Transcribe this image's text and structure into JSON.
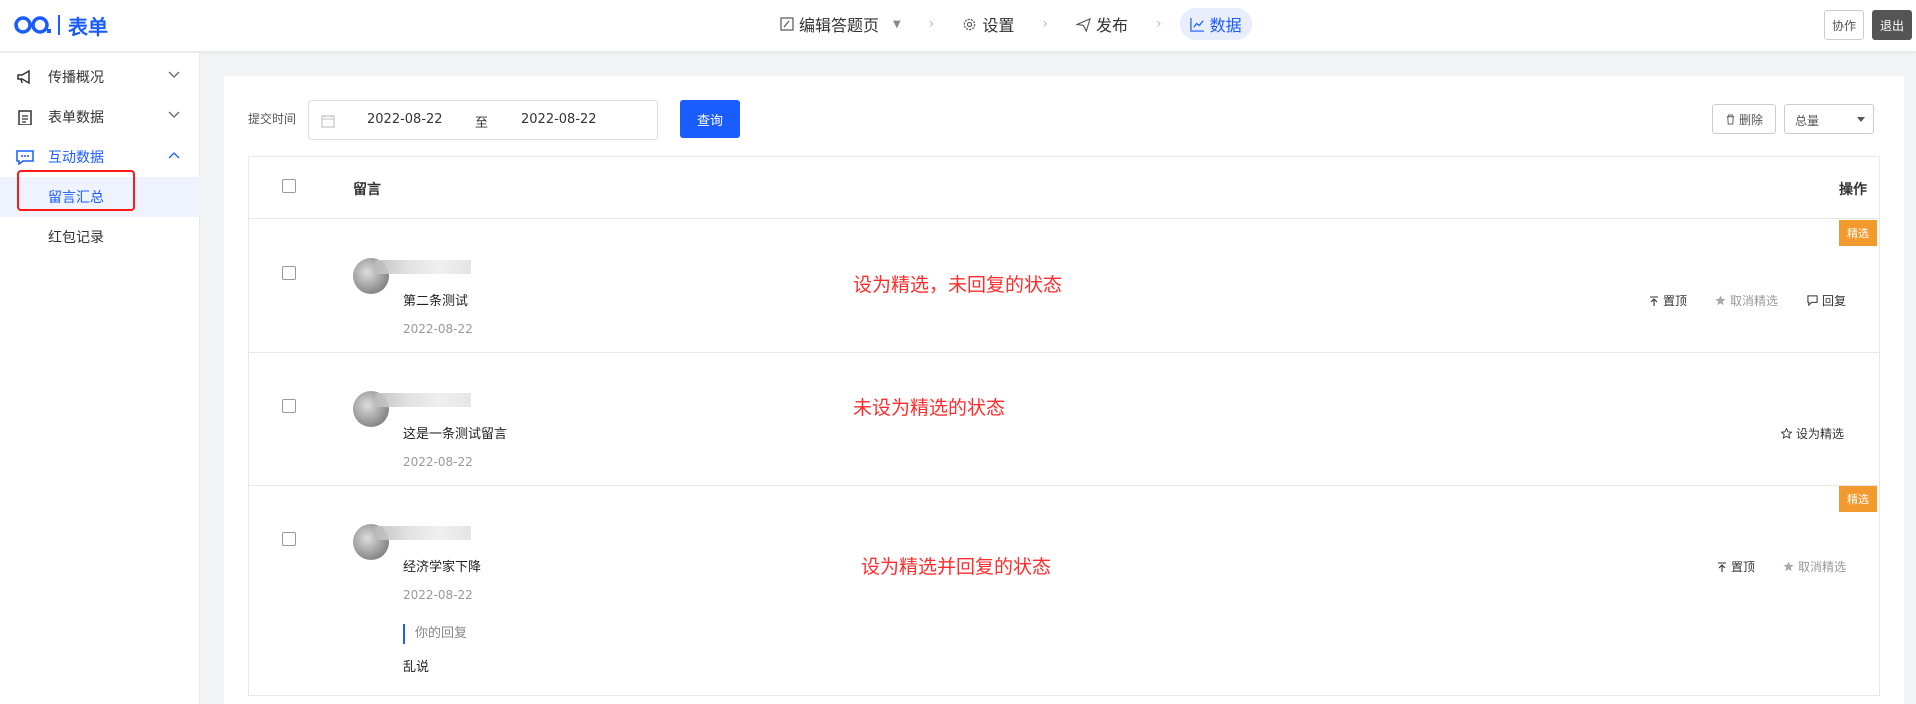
{
  "header": {
    "logo_text": "表单",
    "nav": [
      {
        "label": "编辑答题页",
        "icon": "edit-icon"
      },
      {
        "label": "设置",
        "icon": "gear-icon"
      },
      {
        "label": "发布",
        "icon": "send-icon"
      },
      {
        "label": "数据",
        "icon": "chart-icon",
        "active": true
      }
    ],
    "collab_label": "协作",
    "exit_label": "退出"
  },
  "sidebar": {
    "items": [
      {
        "label": "传播概况",
        "icon": "megaphone-icon"
      },
      {
        "label": "表单数据",
        "icon": "clipboard-icon"
      },
      {
        "label": "互动数据",
        "icon": "chat-icon",
        "expanded": true
      }
    ],
    "subitems": [
      {
        "label": "留言汇总",
        "active": true
      },
      {
        "label": "红包记录"
      }
    ]
  },
  "filter": {
    "label": "提交时间",
    "start": "2022-08-22",
    "separator": "至",
    "end": "2022-08-22",
    "query_label": "查询",
    "delete_label": "删除",
    "select_value": "总量"
  },
  "table": {
    "col_message": "留言",
    "col_action": "操作",
    "rows": [
      {
        "message": "第二条测试",
        "date": "2022-08-22",
        "badge": "精选",
        "note": "设为精选，未回复的状态",
        "actions": [
          {
            "label": "置顶",
            "icon": "pin-icon"
          },
          {
            "label": "取消精选",
            "icon": "star-filled-icon",
            "muted": true
          },
          {
            "label": "回复",
            "icon": "comment-icon"
          }
        ]
      },
      {
        "message": "这是一条测试留言",
        "date": "2022-08-22",
        "note": "未设为精选的状态",
        "actions": [
          {
            "label": "设为精选",
            "icon": "star-outline-icon"
          }
        ]
      },
      {
        "message": "经济学家下降",
        "date": "2022-08-22",
        "badge": "精选",
        "note": "设为精选并回复的状态",
        "reply_label": "你的回复",
        "reply_text": "乱说",
        "actions": [
          {
            "label": "置顶",
            "icon": "pin-icon"
          },
          {
            "label": "取消精选",
            "icon": "star-filled-icon",
            "muted": true
          }
        ]
      }
    ]
  },
  "colors": {
    "accent": "#1a5cff",
    "badge": "#f39a2e",
    "annotation": "#ff2d2d"
  }
}
